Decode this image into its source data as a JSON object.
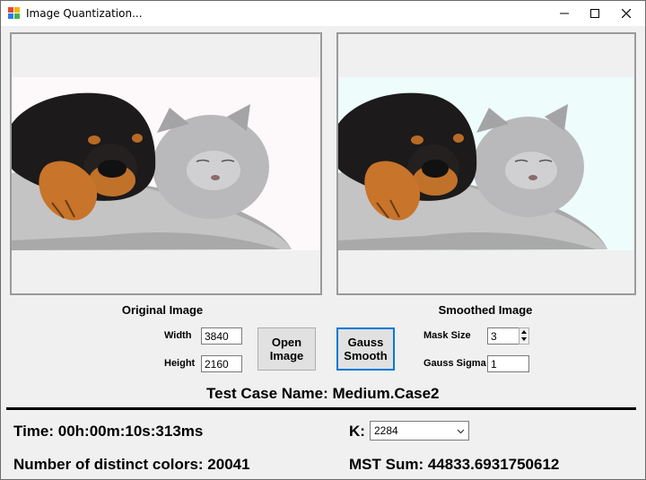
{
  "window": {
    "title": "Image Quantization..."
  },
  "original": {
    "caption": "Original Image"
  },
  "smoothed": {
    "caption": "Smoothed Image"
  },
  "dims": {
    "width_label": "Width",
    "width_value": "3840",
    "height_label": "Height",
    "height_value": "2160"
  },
  "buttons": {
    "open_line1": "Open",
    "open_line2": "Image",
    "gauss_line1": "Gauss",
    "gauss_line2": "Smooth"
  },
  "mask": {
    "label": "Mask Size",
    "value": "3"
  },
  "sigma": {
    "label": "Gauss Sigma",
    "value": "1"
  },
  "test_case": "Test Case Name: Medium.Case2",
  "time": "Time: 00h:00m:10s:313ms",
  "distinct": "Number of distinct colors: 20041",
  "k": {
    "label": "K:",
    "value": "2284"
  },
  "mst": "MST Sum: 44833.6931750612",
  "colors": {
    "focus_border": "#0078d7",
    "picture_bg_original": "#fdf8f9",
    "picture_bg_smoothed": "#eefcfc"
  }
}
